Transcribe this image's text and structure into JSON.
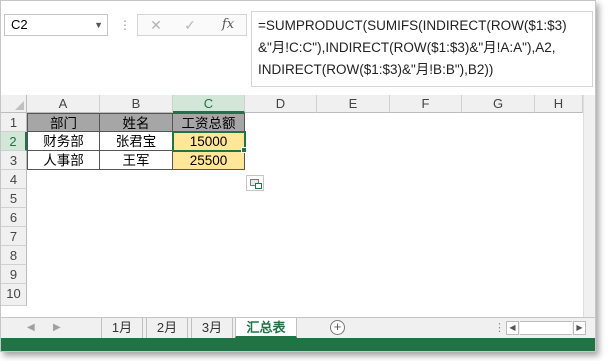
{
  "name_box": "C2",
  "formula_buttons": {
    "cancel": "✕",
    "enter": "✓",
    "fx": "fx"
  },
  "formula": "=SUMPRODUCT(SUMIFS(INDIRECT(ROW($1:$3)\n&\"月!C:C\"),INDIRECT(ROW($1:$3)&\"月!A:A\"),A2,\nINDIRECT(ROW($1:$3)&\"月!B:B\"),B2))",
  "columns": [
    "A",
    "B",
    "C",
    "D",
    "E",
    "F",
    "G",
    "H"
  ],
  "rows": [
    "1",
    "2",
    "3",
    "4",
    "5",
    "6",
    "7",
    "8",
    "9",
    "10"
  ],
  "table": {
    "headers": [
      "部门",
      "姓名",
      "工资总额"
    ],
    "rows": [
      [
        "财务部",
        "张君宝",
        "15000"
      ],
      [
        "人事部",
        "王军",
        "25500"
      ]
    ]
  },
  "selected_cell": "C2",
  "sheets": [
    "1月",
    "2月",
    "3月",
    "汇总表"
  ],
  "active_sheet": "汇总表",
  "colors": {
    "accent": "#217346",
    "header_fill": "#a6a6a6",
    "highlight": "#ffe699"
  }
}
